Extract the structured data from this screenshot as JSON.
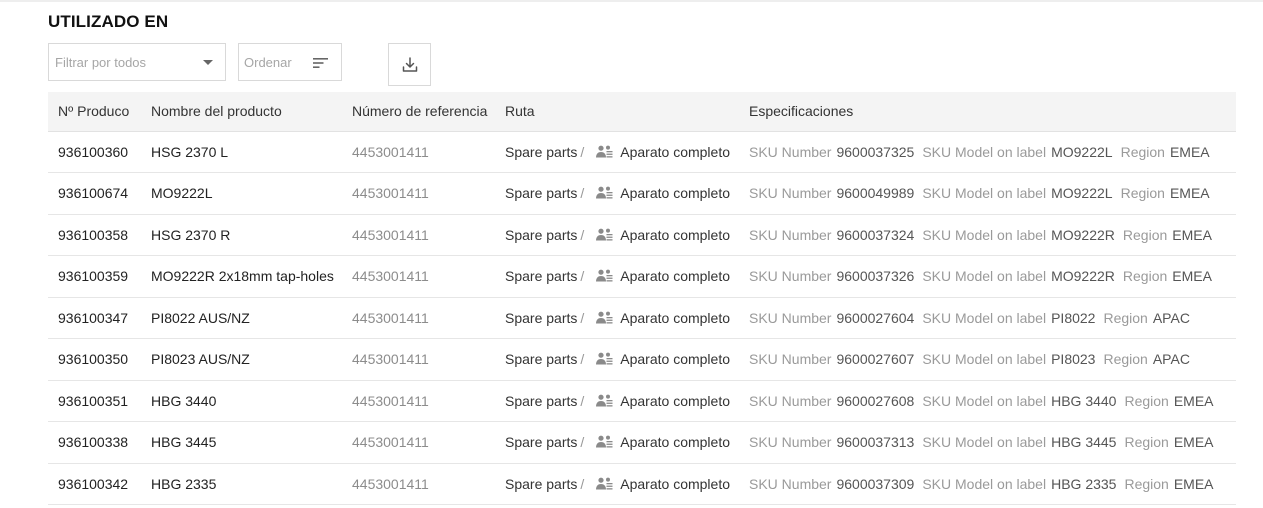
{
  "section": {
    "title": "UTILIZADO EN"
  },
  "toolbar": {
    "filter_placeholder": "Filtrar por todos",
    "sort_placeholder": "Ordenar",
    "download_icon": "download-icon",
    "sort_icon": "sort-lines-icon"
  },
  "table": {
    "headers": {
      "num": "Nº Produco",
      "name": "Nombre del producto",
      "ref": "Número de referencia",
      "route": "Ruta",
      "specs": "Especificaciones"
    },
    "spec_labels": {
      "sku": "SKU Number",
      "model": "SKU Model on label",
      "region": "Region"
    },
    "rows": [
      {
        "num": "936100360",
        "name": "HSG 2370 L",
        "ref": "4453001411",
        "route_a": "Spare parts",
        "route_sep": "/",
        "route_b": "Aparato completo",
        "sku": "9600037325",
        "model": "MO9222L",
        "region": "EMEA"
      },
      {
        "num": "936100674",
        "name": "MO9222L",
        "ref": "4453001411",
        "route_a": "Spare parts",
        "route_sep": "/",
        "route_b": "Aparato completo",
        "sku": "9600049989",
        "model": "MO9222L",
        "region": "EMEA"
      },
      {
        "num": "936100358",
        "name": "HSG 2370 R",
        "ref": "4453001411",
        "route_a": "Spare parts",
        "route_sep": "/",
        "route_b": "Aparato completo",
        "sku": "9600037324",
        "model": "MO9222R",
        "region": "EMEA"
      },
      {
        "num": "936100359",
        "name": "MO9222R 2x18mm tap-holes",
        "ref": "4453001411",
        "route_a": "Spare parts",
        "route_sep": "/",
        "route_b": "Aparato completo",
        "sku": "9600037326",
        "model": "MO9222R",
        "region": "EMEA"
      },
      {
        "num": "936100347",
        "name": "PI8022 AUS/NZ",
        "ref": "4453001411",
        "route_a": "Spare parts",
        "route_sep": "/",
        "route_b": "Aparato completo",
        "sku": "9600027604",
        "model": "PI8022",
        "region": "APAC"
      },
      {
        "num": "936100350",
        "name": "PI8023 AUS/NZ",
        "ref": "4453001411",
        "route_a": "Spare parts",
        "route_sep": "/",
        "route_b": "Aparato completo",
        "sku": "9600027607",
        "model": "PI8023",
        "region": "APAC"
      },
      {
        "num": "936100351",
        "name": "HBG 3440",
        "ref": "4453001411",
        "route_a": "Spare parts",
        "route_sep": "/",
        "route_b": "Aparato completo",
        "sku": "9600027608",
        "model": "HBG 3440",
        "region": "EMEA"
      },
      {
        "num": "936100338",
        "name": "HBG 3445",
        "ref": "4453001411",
        "route_a": "Spare parts",
        "route_sep": "/",
        "route_b": "Aparato completo",
        "sku": "9600037313",
        "model": "HBG 3445",
        "region": "EMEA"
      },
      {
        "num": "936100342",
        "name": "HBG 2335",
        "ref": "4453001411",
        "route_a": "Spare parts",
        "route_sep": "/",
        "route_b": "Aparato completo",
        "sku": "9600037309",
        "model": "HBG 2335",
        "region": "EMEA"
      }
    ]
  }
}
